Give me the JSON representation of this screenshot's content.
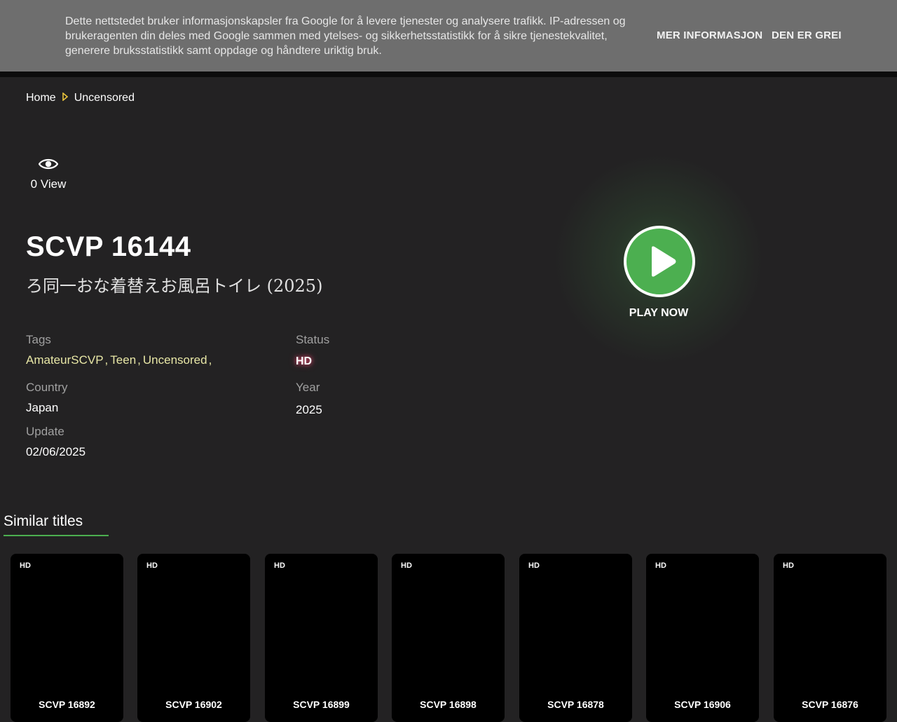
{
  "cookie_banner": {
    "text": "Dette nettstedet bruker informasjonskapsler fra Google for å levere tjenester og analysere trafikk. IP-adressen og brukeragenten din deles med Google sammen med ytelses- og sikkerhetsstatistikk for å sikre tjenestekvalitet, generere bruksstatistikk samt oppdage og håndtere uriktig bruk.",
    "more_info": "MER INFORMASJON",
    "accept": "DEN ER GREI"
  },
  "breadcrumb": {
    "home": "Home",
    "current": "Uncensored"
  },
  "views": {
    "count_label": "0 View"
  },
  "title": "SCVP 16144",
  "subtitle": "ろ同一おな着替えお風呂トイレ (2025)",
  "meta": {
    "tags_label": "Tags",
    "tags": [
      "AmateurSCVP",
      "Teen",
      "Uncensored"
    ],
    "status_label": "Status",
    "status_value": "HD",
    "country_label": "Country",
    "country_value": "Japan",
    "year_label": "Year",
    "year_value": "2025",
    "update_label": "Update",
    "update_value": "02/06/2025"
  },
  "play": {
    "label": "PLAY NOW"
  },
  "similar": {
    "heading": "Similar titles",
    "items": [
      {
        "badge": "HD",
        "title": "SCVP 16892"
      },
      {
        "badge": "HD",
        "title": "SCVP 16902"
      },
      {
        "badge": "HD",
        "title": "SCVP 16899"
      },
      {
        "badge": "HD",
        "title": "SCVP 16898"
      },
      {
        "badge": "HD",
        "title": "SCVP 16878"
      },
      {
        "badge": "HD",
        "title": "SCVP 16906"
      },
      {
        "badge": "HD",
        "title": "SCVP 16876"
      }
    ]
  },
  "colors": {
    "accent": "#4caf50",
    "tag": "#e8e7a6",
    "background": "#232223",
    "banner": "#6e6e6e"
  }
}
